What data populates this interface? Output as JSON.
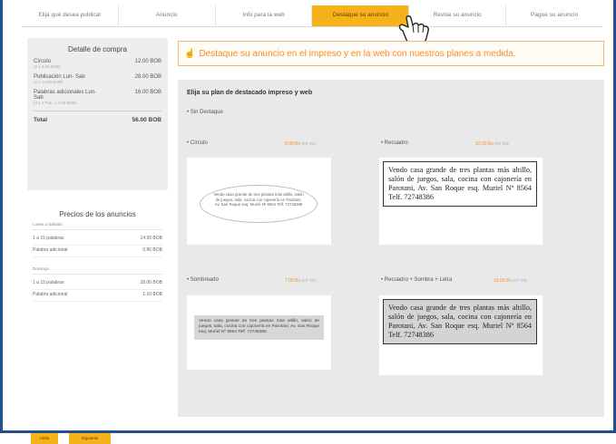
{
  "nav": {
    "tabs": [
      {
        "label": "Elija qué desea publicar"
      },
      {
        "label": "Anuncio"
      },
      {
        "label": "Info para la web"
      },
      {
        "label": "Destaque su anuncio"
      },
      {
        "label": "Revise su anuncio"
      },
      {
        "label": "Pague su anuncio"
      }
    ],
    "active_index": 3
  },
  "compra": {
    "title": "Detalle de compra",
    "rows": [
      {
        "name": "Círculo",
        "price": "12.00 BOB",
        "sub": "(2 x 6.00 BOB)"
      },
      {
        "name": "Publicación Lun- Sab",
        "price": "28.00 BOB",
        "sub": "(2 x 14.00 BOB)"
      },
      {
        "name": "Palabras adicionales Lun-Sab",
        "price": "16.00 BOB",
        "sub": "(4 x 2 Pub. x 2.00 BOB)"
      }
    ],
    "total_label": "Total",
    "total_value": "56.00 BOB"
  },
  "precios": {
    "title": "Precios de los anuncios",
    "groups": [
      {
        "heading": "Lunes a Sábado",
        "rows": [
          {
            "name": "1 a 15 palabras",
            "price": "14.00 BOB"
          },
          {
            "name": "Palabra adicional",
            "price": "0.80 BOB"
          }
        ]
      },
      {
        "heading": "Domingo",
        "rows": [
          {
            "name": "1 a 15 palabras",
            "price": "18.00 BOB"
          },
          {
            "name": "Palabra adicional",
            "price": "1.10 BOB"
          }
        ]
      }
    ]
  },
  "banner": {
    "text": "Destaque su anuncio en el impreso y en la web con nuestros planes a medida."
  },
  "panel": {
    "title": "Elija su plan de destacado impreso y web",
    "none_label": "Sin Destaque",
    "options": [
      {
        "label": "Círculo",
        "price": "6.00 Bs",
        "unit": "por día"
      },
      {
        "label": "Recuadro",
        "price": "10.00 Bs",
        "unit": "por día"
      },
      {
        "label": "Sombreado",
        "price": "7.00 Bs",
        "unit": "por día"
      },
      {
        "label": "Recuadro + Sombra + Letra",
        "price": "15.00 Bs",
        "unit": "por día"
      }
    ],
    "ad_text": "Vendo casa grande de tres plantas más altillo, salón de juegos, sala, cocina con cajonería en Parotani, Av. San Roque esq. Muriel Nº 8564 Telf. 72748386"
  },
  "buttons": [
    {
      "label": "Atrás"
    },
    {
      "label": "Siguiente"
    }
  ],
  "colors": {
    "accent": "#f6b21a",
    "banner_text": "#f0922e",
    "frame_blue": "#1f4f8f",
    "panel_bg": "#e9e9e9"
  }
}
